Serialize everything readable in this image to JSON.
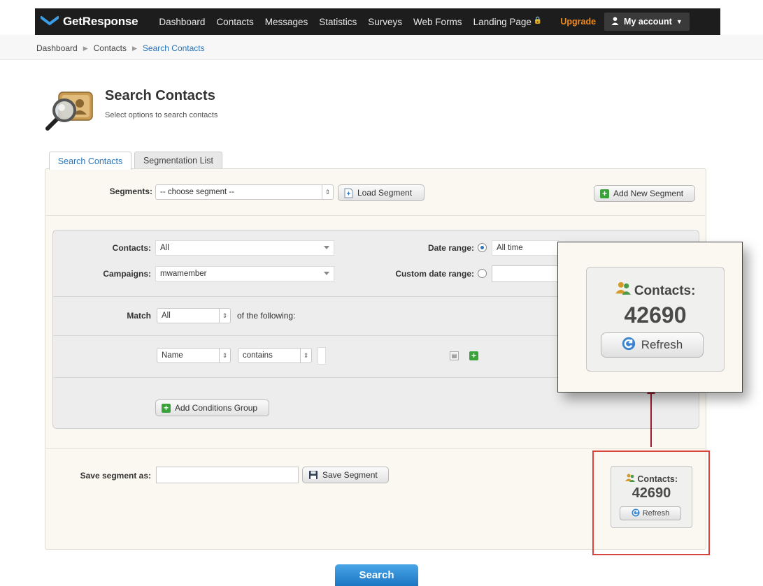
{
  "app": {
    "brand": "GetResponse"
  },
  "nav": {
    "items": [
      "Dashboard",
      "Contacts",
      "Messages",
      "Statistics",
      "Surveys",
      "Web Forms",
      "Landing Page"
    ],
    "upgrade": "Upgrade",
    "account": "My account"
  },
  "breadcrumb": [
    "Dashboard",
    "Contacts",
    "Search Contacts"
  ],
  "header": {
    "title": "Search Contacts",
    "subtitle": "Select options to search contacts"
  },
  "tabs": [
    {
      "label": "Search Contacts",
      "active": true
    },
    {
      "label": "Segmentation List",
      "active": false
    }
  ],
  "segments": {
    "label": "Segments:",
    "selected": "-- choose segment --",
    "load_button": "Load Segment",
    "add_button": "Add New Segment"
  },
  "filters": {
    "contacts_label": "Contacts:",
    "contacts_value": "All",
    "campaigns_label": "Campaigns:",
    "campaigns_value": "mwamember",
    "date_range_label": "Date range:",
    "date_range_value": "All time",
    "custom_date_label": "Custom date range:"
  },
  "match": {
    "label": "Match",
    "value": "All",
    "suffix": "of the following:"
  },
  "condition": {
    "field": "Name",
    "operator": "contains",
    "value": ""
  },
  "add_group_button": "Add Conditions Group",
  "save": {
    "label": "Save segment as:",
    "value": "",
    "button": "Save Segment"
  },
  "contacts_box": {
    "label": "Contacts:",
    "count": "42690",
    "refresh": "Refresh"
  },
  "search_button": "Search",
  "colors": {
    "accent": "#2b75b8",
    "upgrade": "#f08a1c",
    "highlight": "#d9453e",
    "arrow": "#9b1c2a",
    "add": "#3aa23a"
  }
}
